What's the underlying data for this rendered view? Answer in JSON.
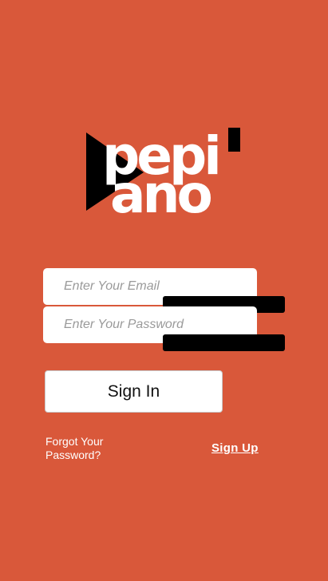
{
  "app": {
    "background_color": "#d9583a",
    "logo_text_top": "pepi",
    "logo_text_bottom": "ano"
  },
  "login": {
    "email_placeholder": "Enter Your Email",
    "email_value": "",
    "password_placeholder": "Enter Your Password",
    "password_value": "",
    "signin_label": "Sign In",
    "forgot_label": "Forgot Your Password?",
    "signup_label": "Sign Up"
  }
}
